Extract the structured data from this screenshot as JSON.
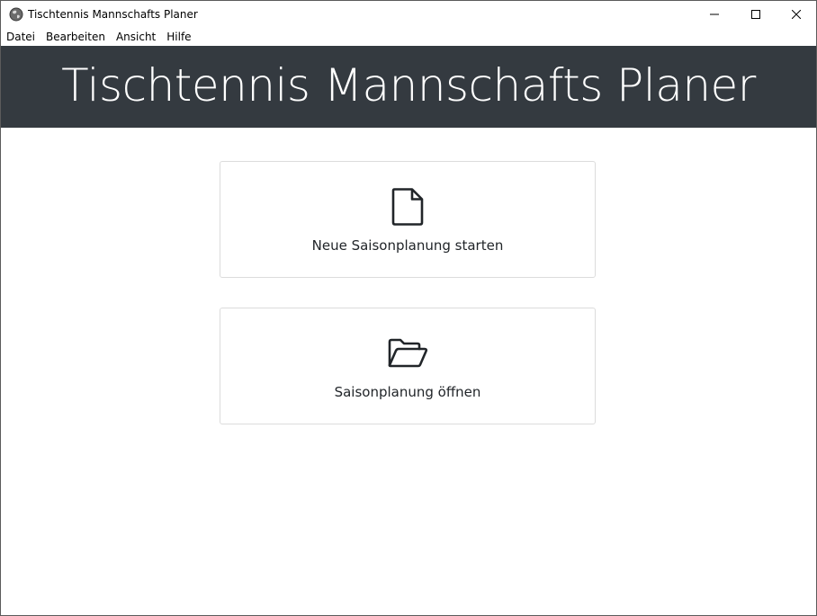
{
  "window": {
    "title": "Tischtennis Mannschafts Planer"
  },
  "menu": {
    "items": [
      {
        "label": "Datei"
      },
      {
        "label": "Bearbeiten"
      },
      {
        "label": "Ansicht"
      },
      {
        "label": "Hilfe"
      }
    ]
  },
  "header": {
    "title": "Tischtennis Mannschafts Planer"
  },
  "actions": {
    "new_label": "Neue Saisonplanung starten",
    "new_icon": "file-icon",
    "open_label": "Saisonplanung öffnen",
    "open_icon": "folder-open-icon"
  },
  "colors": {
    "banner": "#343a40",
    "banner_text": "#ffffff",
    "card_border": "#dcdcdc",
    "text": "#212529"
  }
}
